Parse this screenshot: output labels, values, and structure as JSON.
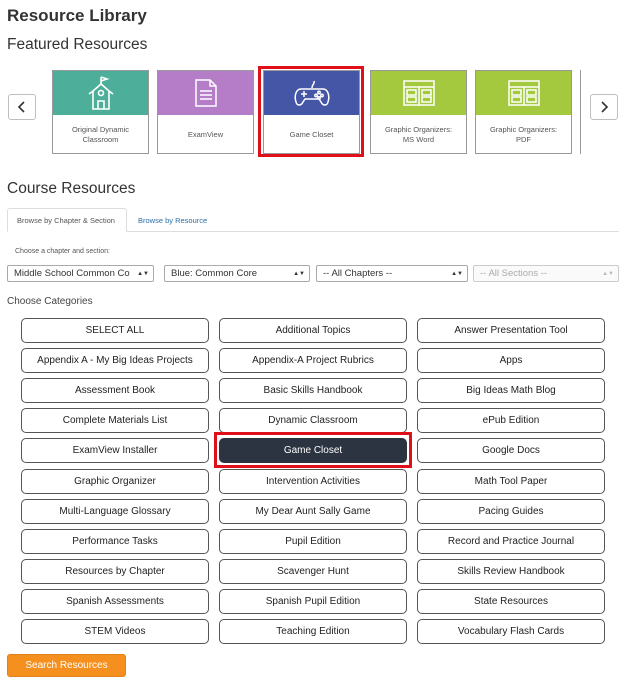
{
  "page": {
    "title": "Resource Library"
  },
  "featured": {
    "title": "Featured Resources",
    "cards": [
      {
        "label": "Original Dynamic\nClassroom",
        "icon": "schoolhouse-icon",
        "color": "#4daf9a"
      },
      {
        "label": "ExamView",
        "icon": "document-icon",
        "color": "#b57cc8"
      },
      {
        "label": "Game Closet",
        "icon": "gamepad-icon",
        "color": "#4556a7"
      },
      {
        "label": "Graphic Organizers:\nMS Word",
        "icon": "organizer-icon",
        "color": "#a4c93e"
      },
      {
        "label": "Graphic Organizers:\nPDF",
        "icon": "organizer-icon",
        "color": "#a4c93e"
      }
    ]
  },
  "course": {
    "title": "Course Resources",
    "tabs": [
      "Browse by Chapter & Section",
      "Browse by Resource"
    ],
    "choose_label": "Choose a chapter and section:",
    "selects": [
      "Middle School Common Co",
      "Blue: Common Core",
      "-- All Chapters --",
      "-- All Sections --"
    ],
    "categories_label": "Choose Categories",
    "categories": [
      "SELECT ALL",
      "Additional Topics",
      "Answer Presentation Tool",
      "Appendix A - My Big Ideas Projects",
      "Appendix-A Project Rubrics",
      "Apps",
      "Assessment Book",
      "Basic Skills Handbook",
      "Big Ideas Math Blog",
      "Complete Materials List",
      "Dynamic Classroom",
      "ePub Edition",
      "ExamView Installer",
      "Game Closet",
      "Google Docs",
      "Graphic Organizer",
      "Intervention Activities",
      "Math Tool Paper",
      "Multi-Language Glossary",
      "My Dear Aunt Sally Game",
      "Pacing Guides",
      "Performance Tasks",
      "Pupil Edition",
      "Record and Practice Journal",
      "Resources by Chapter",
      "Scavenger Hunt",
      "Skills Review Handbook",
      "Spanish Assessments",
      "Spanish Pupil Edition",
      "State Resources",
      "STEM Videos",
      "Teaching Edition",
      "Vocabulary Flash Cards"
    ],
    "selected_category": "Game Closet",
    "search_label": "Search Resources"
  },
  "colors": {
    "highlight": "#e0101a",
    "selected_button": "#2b3440",
    "search_button": "#f5901e",
    "link": "#2a6fa8"
  }
}
